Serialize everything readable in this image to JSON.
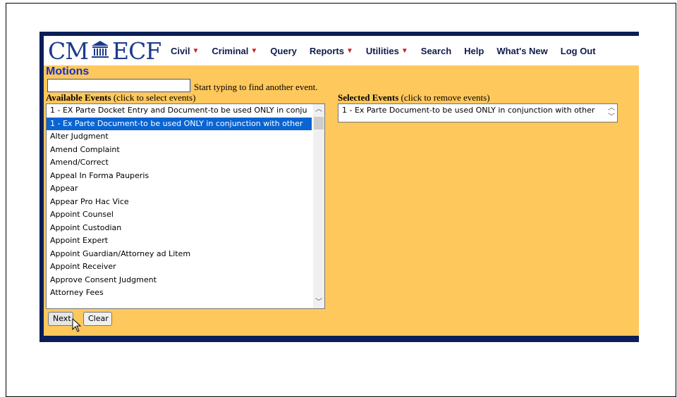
{
  "logo": {
    "left": "CM",
    "right": "ECF"
  },
  "nav": {
    "items": [
      {
        "label": "Civil",
        "caret": true
      },
      {
        "label": "Criminal",
        "caret": true
      },
      {
        "label": "Query",
        "caret": false
      },
      {
        "label": "Reports",
        "caret": true
      },
      {
        "label": "Utilities",
        "caret": true
      },
      {
        "label": "Search",
        "caret": false
      },
      {
        "label": "Help",
        "caret": false
      },
      {
        "label": "What's New",
        "caret": false
      },
      {
        "label": "Log Out",
        "caret": false
      }
    ]
  },
  "page": {
    "title": "Motions",
    "search_value": "",
    "search_hint": "Start typing to find another event."
  },
  "available": {
    "heading_bold": "Available Events",
    "heading_rest": " (click to select events)",
    "options": [
      "1 - EX Parte Docket Entry and Document-to be used ONLY in conju",
      "1 - Ex Parte Document-to be used ONLY in conjunction with other",
      "Alter Judgment",
      "Amend Complaint",
      "Amend/Correct",
      "Appeal In Forma Pauperis",
      "Appear",
      "Appear Pro Hac Vice",
      "Appoint Counsel",
      "Appoint Custodian",
      "Appoint Expert",
      "Appoint Guardian/Attorney ad Litem",
      "Appoint Receiver",
      "Approve Consent Judgment",
      "Attorney Fees"
    ],
    "selected_index": 1
  },
  "selected": {
    "heading_bold": "Selected Events",
    "heading_rest": " (click to remove events)",
    "options": [
      "1 - Ex Parte Document-to be used ONLY in conjunction with other"
    ]
  },
  "buttons": {
    "next": "Next",
    "clear": "Clear"
  },
  "colors": {
    "nav_bg": "#0b1e57",
    "content_bg": "#ffc85c",
    "title": "#1430c8",
    "selection": "#0a64d2",
    "caret": "#cc1d1d"
  }
}
